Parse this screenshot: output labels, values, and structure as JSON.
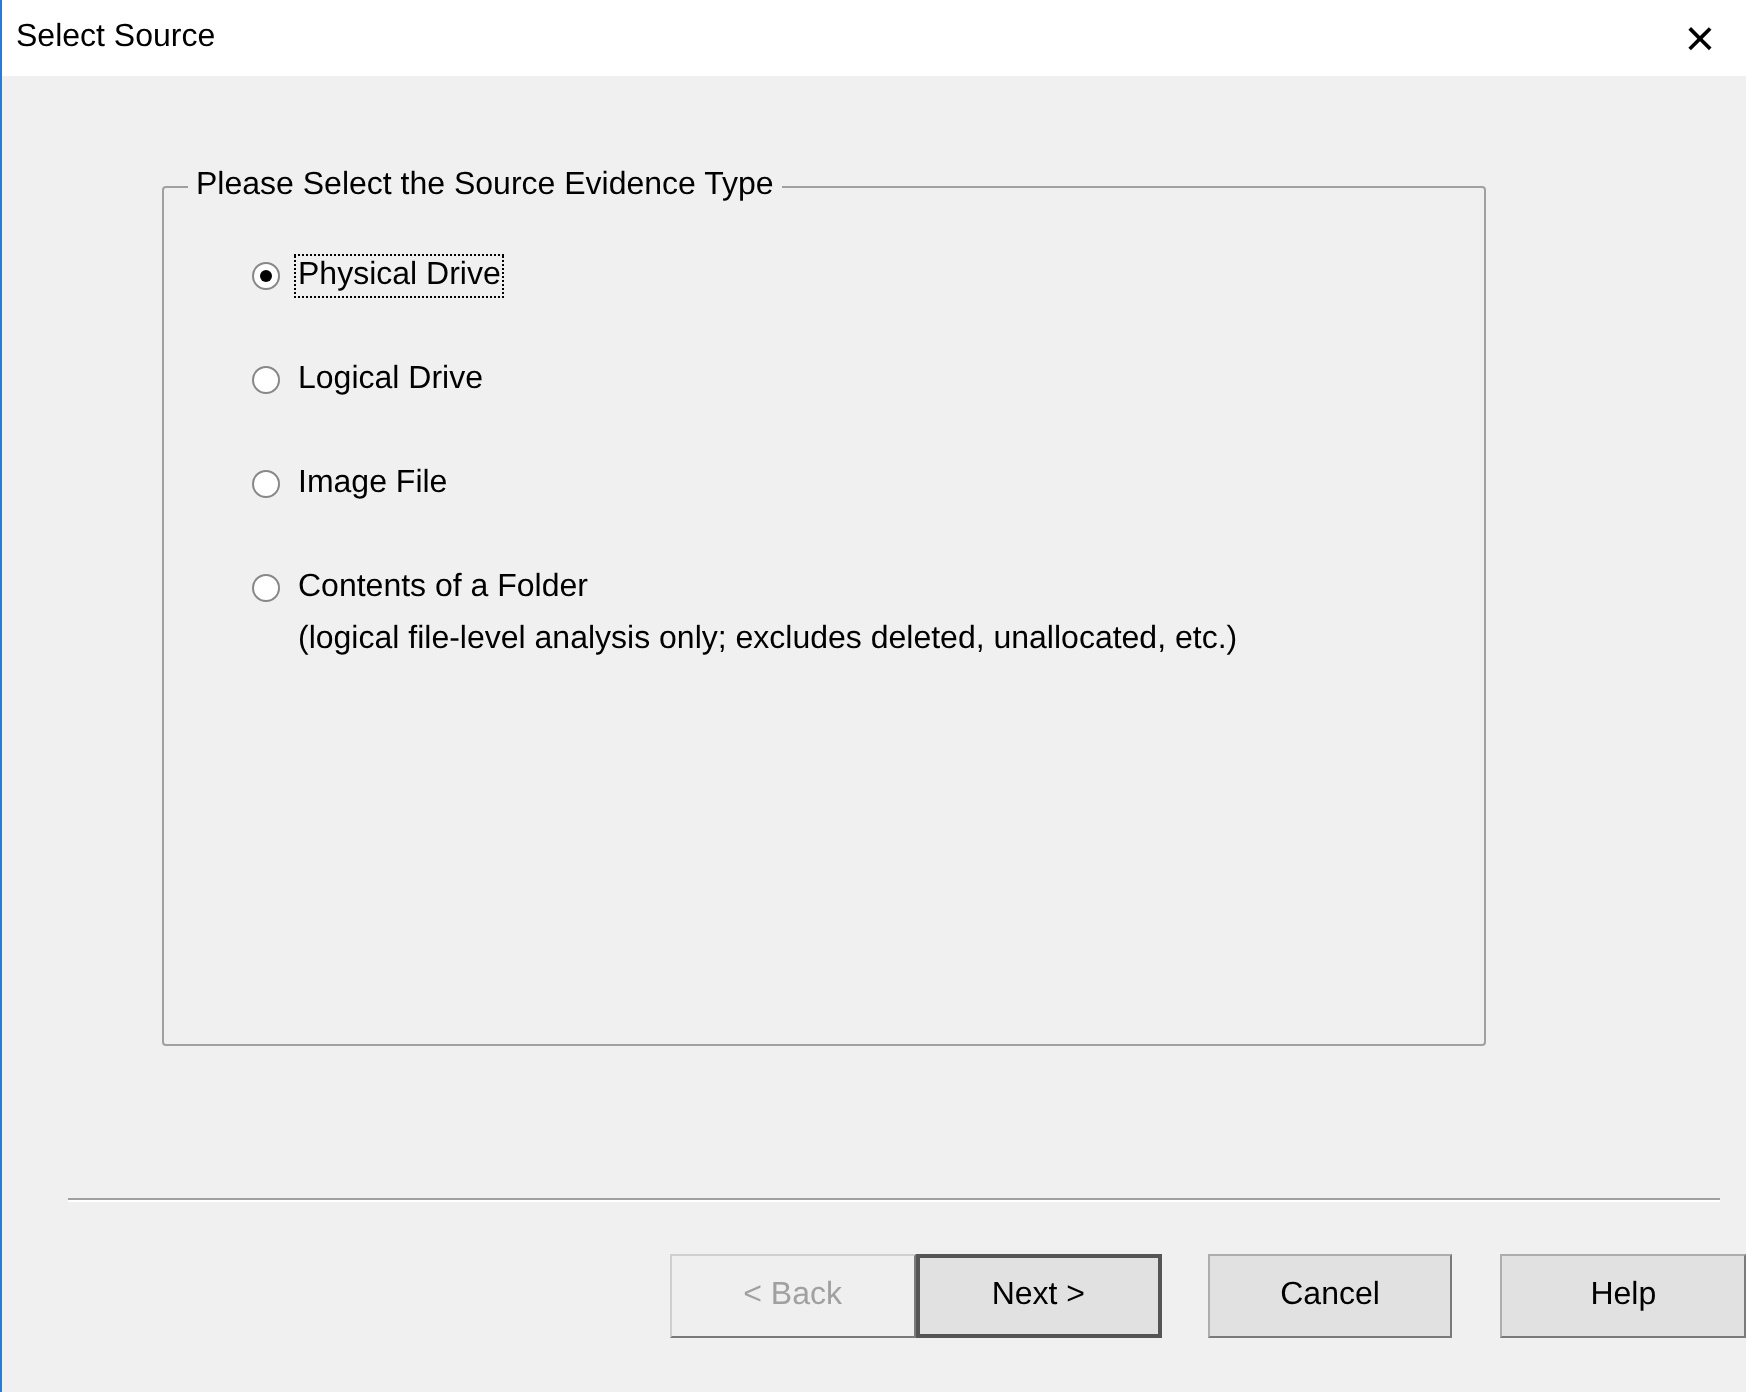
{
  "window": {
    "title": "Select Source",
    "close": "×"
  },
  "group": {
    "legend": "Please Select the Source Evidence Type",
    "options": [
      {
        "label": "Physical Drive",
        "selected": true
      },
      {
        "label": "Logical Drive",
        "selected": false
      },
      {
        "label": "Image File",
        "selected": false
      },
      {
        "label": "Contents of a Folder",
        "note": "(logical file-level analysis only; excludes deleted, unallocated, etc.)",
        "selected": false
      }
    ]
  },
  "buttons": [
    {
      "label": "< Back",
      "disabled": true,
      "default": false
    },
    {
      "label": "Next >",
      "disabled": false,
      "default": true
    },
    {
      "label": "Cancel",
      "disabled": false,
      "default": false
    },
    {
      "label": "Help",
      "disabled": false,
      "default": false
    }
  ]
}
